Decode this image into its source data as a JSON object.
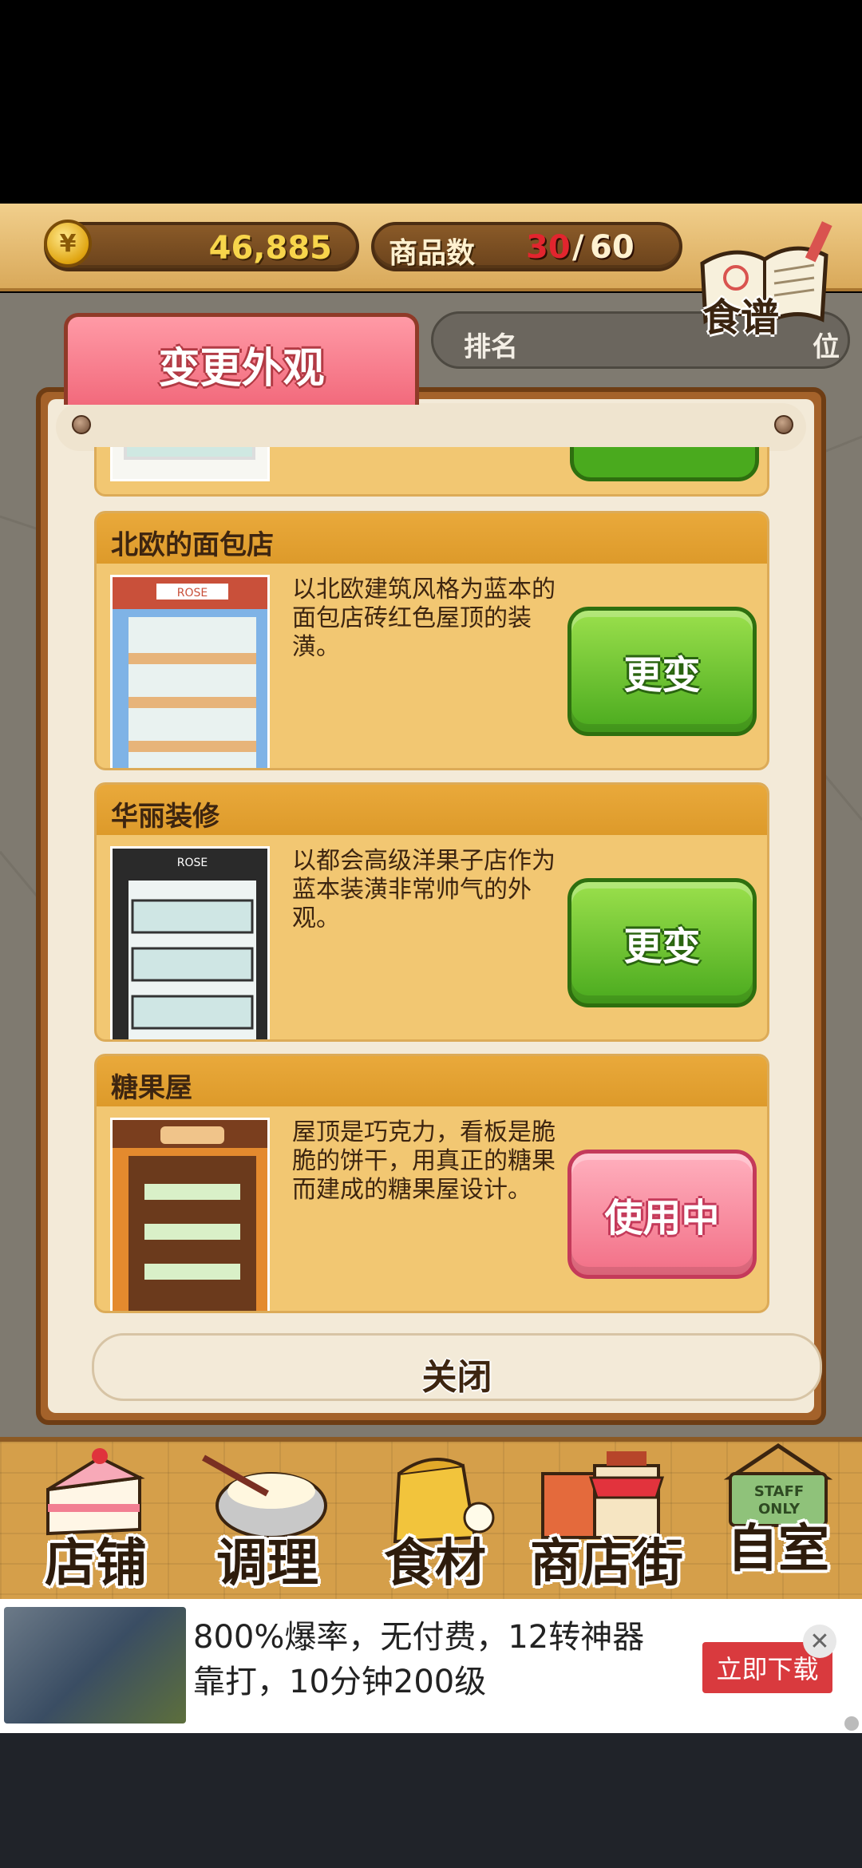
{
  "topbar": {
    "coins": "46,885",
    "goods_label": "商品数",
    "goods_count": "30",
    "goods_sep": "/",
    "goods_max": "60",
    "coin_symbol": "¥",
    "recipe_label": "食谱"
  },
  "rank": {
    "label": "排名",
    "unit": "位"
  },
  "dialog": {
    "tab_title": "变更外观",
    "close_label": "关闭",
    "items": [
      {
        "title": "北欧的面包店",
        "description": "以北欧建筑风格为蓝本的面包店砖红色屋顶的装潢。",
        "button": "更变",
        "state": "available"
      },
      {
        "title": "华丽装修",
        "description": "以都会高级洋果子店作为蓝本装潢非常帅气的外观。",
        "button": "更变",
        "state": "available"
      },
      {
        "title": "糖果屋",
        "description": "屋顶是巧克力，看板是脆脆的饼干，用真正的糖果而建成的糖果屋设计。",
        "button": "使用中",
        "state": "in-use"
      }
    ]
  },
  "nav": {
    "shop": "店铺",
    "cook": "调理",
    "ingredients": "食材",
    "street": "商店街",
    "room": "自室",
    "room_sign": "STAFF ONLY"
  },
  "ad": {
    "text": "800%爆率，无付费，12转神器靠打，10分钟200级",
    "button": "立即下载",
    "close": "✕"
  },
  "colors": {
    "accent_green": "#4aaa1e",
    "accent_pink": "#f26f86",
    "card": "#f2c772"
  }
}
